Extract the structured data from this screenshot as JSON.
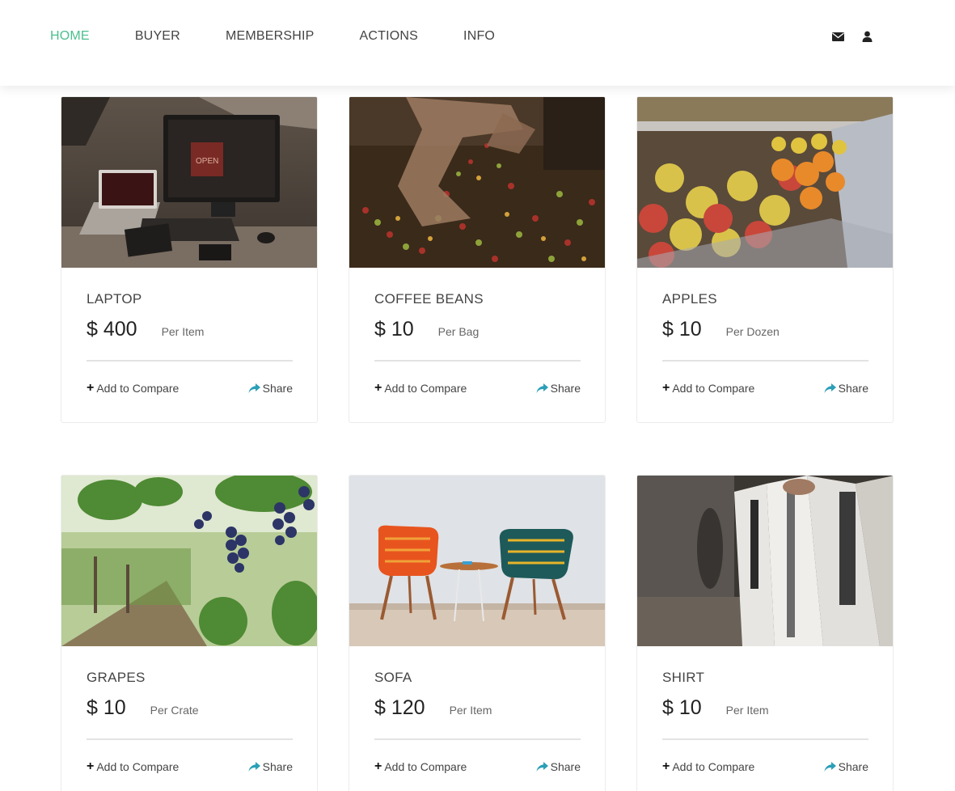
{
  "nav": {
    "items": [
      {
        "label": "HOME",
        "active": true
      },
      {
        "label": "BUYER",
        "active": false
      },
      {
        "label": "MEMBERSHIP",
        "active": false
      },
      {
        "label": "ACTIONS",
        "active": false
      },
      {
        "label": "INFO",
        "active": false
      }
    ],
    "icons": [
      "envelope-icon",
      "user-icon"
    ],
    "active_color": "#4cbf8e"
  },
  "products": [
    {
      "title": "LAPTOP",
      "price": "$ 400",
      "unit": "Per Item",
      "compare_label": "Add to Compare",
      "share_label": "Share",
      "image": "laptop-desk-photo"
    },
    {
      "title": "COFFEE BEANS",
      "price": "$ 10",
      "unit": "Per Bag",
      "compare_label": "Add to Compare",
      "share_label": "Share",
      "image": "coffee-beans-photo"
    },
    {
      "title": "APPLES",
      "price": "$ 10",
      "unit": "Per Dozen",
      "compare_label": "Add to Compare",
      "share_label": "Share",
      "image": "apples-display-photo"
    },
    {
      "title": "GRAPES",
      "price": "$ 10",
      "unit": "Per Crate",
      "compare_label": "Add to Compare",
      "share_label": "Share",
      "image": "vineyard-grapes-photo"
    },
    {
      "title": "SOFA",
      "price": "$ 120",
      "unit": "Per Item",
      "compare_label": "Add to Compare",
      "share_label": "Share",
      "image": "chairs-photo"
    },
    {
      "title": "SHIRT",
      "price": "$ 10",
      "unit": "Per Item",
      "compare_label": "Add to Compare",
      "share_label": "Share",
      "image": "shirts-rack-photo"
    }
  ],
  "colors": {
    "accent": "#4cbf8e",
    "share_icon": "#2b9fb8"
  }
}
